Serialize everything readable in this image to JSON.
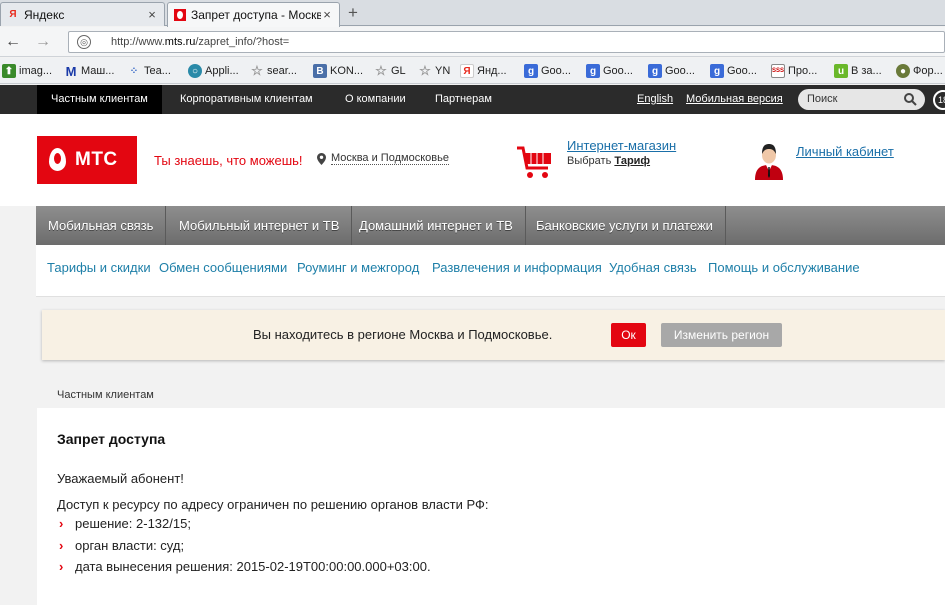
{
  "browser": {
    "tabs": [
      {
        "title": "Яндекс",
        "close": "×"
      },
      {
        "title": "Запрет доступа - Москв...",
        "close": "×"
      }
    ],
    "new_tab": "+",
    "back": "←",
    "forward": "→",
    "url_prefix": "http://www.",
    "url_host": "mts.ru",
    "url_path": "/zapret_info/?host=",
    "bookmarks": [
      "imag...",
      "Маш...",
      "Tea...",
      "Appli...",
      "sear...",
      "KON...",
      "GL",
      "YN",
      "Янд...",
      "Goo...",
      "Goo...",
      "Goo...",
      "Goo...",
      "Про...",
      "В за...",
      "Фор..."
    ]
  },
  "topnav": {
    "items": [
      "Частным клиентам",
      "Корпоративным клиентам",
      "О компании",
      "Партнерам"
    ],
    "english": "English",
    "mobile": "Мобильная версия",
    "search_placeholder": "Поиск"
  },
  "header": {
    "logo_text": "МТС",
    "slogan": "Ты знаешь, что можешь!",
    "region": "Москва и Подмосковье",
    "shop_link": "Интернет-магазин",
    "shop_sub_prefix": "Выбрать",
    "shop_sub_link": "Тариф",
    "cabinet": "Личный кабинет"
  },
  "main_nav": [
    "Мобильная связь",
    "Мобильный интернет и ТВ",
    "Домашний интернет и ТВ",
    "Банковские услуги и платежи"
  ],
  "sub_nav": [
    "Тарифы и скидки",
    "Обмен сообщениями",
    "Роуминг и межгород",
    "Развлечения и информация",
    "Удобная связь",
    "Помощь и обслуживание"
  ],
  "region_banner": {
    "text": "Вы находитесь в регионе Москва и Подмосковье.",
    "ok": "Ок",
    "change": "Изменить регион"
  },
  "breadcrumb": "Частным клиентам",
  "content": {
    "title": "Запрет доступа",
    "greeting": "Уважаемый абонент!",
    "intro": "Доступ к ресурсу по адресу ограничен по решению органов власти РФ:",
    "items": [
      "решение: 2-132/15;",
      "орган власти: суд;",
      "дата вынесения решения: 2015-02-19T00:00:00.000+03:00."
    ]
  },
  "colors": {
    "mts_red": "#e30611",
    "link_blue": "#1a6fa8",
    "topnav_bg": "#2b2b2b",
    "banner_bg": "#f8f1e4"
  }
}
